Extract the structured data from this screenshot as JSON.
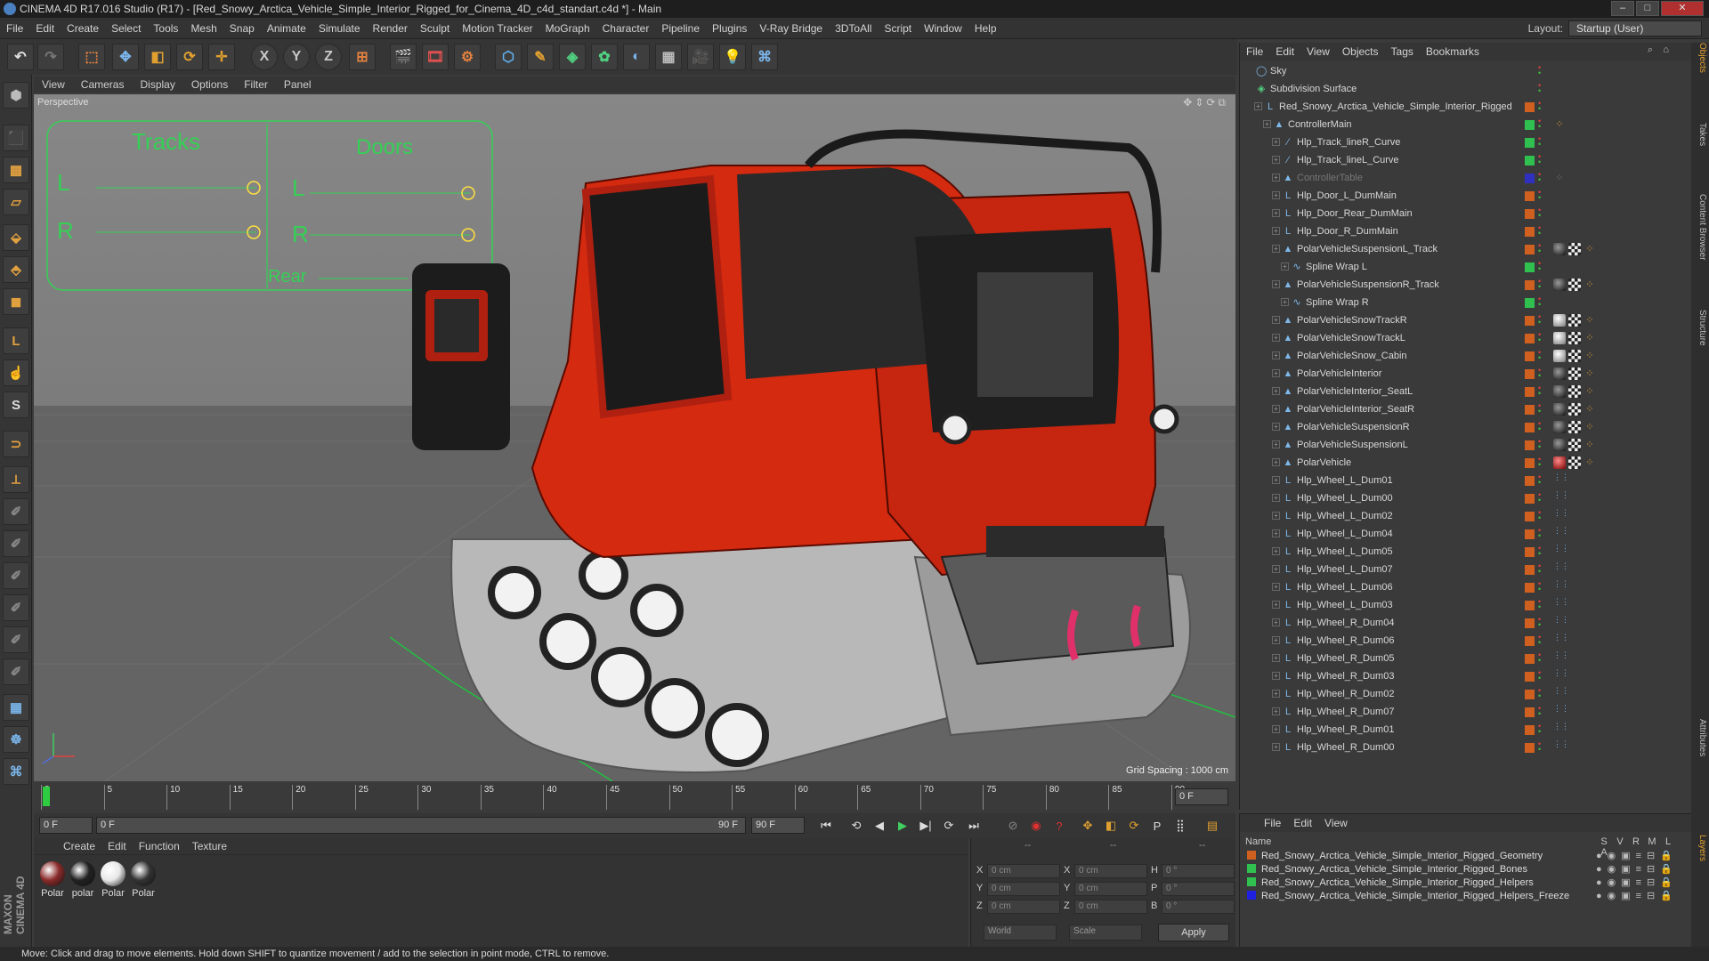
{
  "window": {
    "title": "CINEMA 4D R17.016 Studio (R17) - [Red_Snowy_Arctica_Vehicle_Simple_Interior_Rigged_for_Cinema_4D_c4d_standart.c4d *] - Main"
  },
  "menubar": {
    "items": [
      "File",
      "Edit",
      "Create",
      "Select",
      "Tools",
      "Mesh",
      "Snap",
      "Animate",
      "Simulate",
      "Render",
      "Sculpt",
      "Motion Tracker",
      "MoGraph",
      "Character",
      "Pipeline",
      "Plugins",
      "V-Ray Bridge",
      "3DToAll",
      "Script",
      "Window",
      "Help"
    ],
    "layout_label": "Layout:",
    "layout_value": "Startup (User)"
  },
  "toolbar": {
    "axis_x": "X",
    "axis_y": "Y",
    "axis_z": "Z"
  },
  "viewport": {
    "menu": [
      "View",
      "Cameras",
      "Display",
      "Options",
      "Filter",
      "Panel"
    ],
    "label": "Perspective",
    "grid_spacing": "Grid Spacing : 1000 cm",
    "hud": {
      "tracks_title": "Tracks",
      "doors_title": "Doors",
      "left": "L",
      "right": "R",
      "rear": "Rear"
    }
  },
  "timeline": {
    "ticks": [
      "0",
      "5",
      "10",
      "15",
      "20",
      "25",
      "30",
      "35",
      "40",
      "45",
      "50",
      "55",
      "60",
      "65",
      "70",
      "75",
      "80",
      "85",
      "90"
    ],
    "frame_right": "0 F",
    "current_frame": "0 F",
    "range_start": "0 F",
    "range_end_slider": "90 F",
    "range_end": "90 F"
  },
  "materials": {
    "menu": [
      "Create",
      "Edit",
      "Function",
      "Texture"
    ],
    "items": [
      {
        "label": "Polar",
        "color": "#8a2a2a"
      },
      {
        "label": "polar",
        "color": "#222222"
      },
      {
        "label": "Polar",
        "color": "#e8e8e8"
      },
      {
        "label": "Polar",
        "color": "#333333"
      }
    ]
  },
  "coordinates": {
    "header_dashes": "--",
    "x_label": "X",
    "y_label": "Y",
    "z_label": "Z",
    "h_label": "H",
    "p_label": "P",
    "b_label": "B",
    "pos_value": "0 cm",
    "rot_value": "0 °",
    "world": "World",
    "scale": "Scale",
    "apply": "Apply"
  },
  "object_manager": {
    "menu": [
      "File",
      "Edit",
      "View",
      "Objects",
      "Tags",
      "Bookmarks"
    ],
    "rows": [
      {
        "name": "Sky",
        "indent": 0,
        "icon": "sky",
        "layer": "",
        "tags": []
      },
      {
        "name": "Subdivision Surface",
        "indent": 0,
        "icon": "subdiv",
        "layer": "",
        "tags": []
      },
      {
        "name": "Red_Snowy_Arctica_Vehicle_Simple_Interior_Rigged",
        "indent": 1,
        "icon": "null",
        "layer": "#d06020",
        "tags": []
      },
      {
        "name": "ControllerMain",
        "indent": 2,
        "icon": "ctrl",
        "layer": "#30c050",
        "tags": [
          "orange"
        ]
      },
      {
        "name": "Hlp_Track_lineR_Curve",
        "indent": 3,
        "icon": "spline",
        "layer": "#30c050",
        "tags": []
      },
      {
        "name": "Hlp_Track_lineL_Curve",
        "indent": 3,
        "icon": "spline",
        "layer": "#30c050",
        "tags": []
      },
      {
        "name": "ControllerTable",
        "indent": 3,
        "icon": "ctrl",
        "layer": "#3030c0",
        "tags": [
          "grey"
        ],
        "dim": true
      },
      {
        "name": "Hlp_Door_L_DumMain",
        "indent": 3,
        "icon": "null",
        "layer": "#d06020",
        "tags": []
      },
      {
        "name": "Hlp_Door_Rear_DumMain",
        "indent": 3,
        "icon": "null",
        "layer": "#d06020",
        "tags": []
      },
      {
        "name": "Hlp_Door_R_DumMain",
        "indent": 3,
        "icon": "null",
        "layer": "#d06020",
        "tags": []
      },
      {
        "name": "PolarVehicleSuspensionL_Track",
        "indent": 3,
        "icon": "poly",
        "layer": "#d06020",
        "tags": [
          "dark",
          "checker",
          "orange"
        ]
      },
      {
        "name": "Spline Wrap L",
        "indent": 4,
        "icon": "deform",
        "layer": "#30c050",
        "tags": []
      },
      {
        "name": "PolarVehicleSuspensionR_Track",
        "indent": 3,
        "icon": "poly",
        "layer": "#d06020",
        "tags": [
          "dark",
          "checker",
          "orange"
        ]
      },
      {
        "name": "Spline Wrap R",
        "indent": 4,
        "icon": "deform",
        "layer": "#30c050",
        "tags": []
      },
      {
        "name": "PolarVehicleSnowTrackR",
        "indent": 3,
        "icon": "poly",
        "layer": "#d06020",
        "tags": [
          "white",
          "checker",
          "orange"
        ]
      },
      {
        "name": "PolarVehicleSnowTrackL",
        "indent": 3,
        "icon": "poly",
        "layer": "#d06020",
        "tags": [
          "white",
          "checker",
          "orange"
        ]
      },
      {
        "name": "PolarVehicleSnow_Cabin",
        "indent": 3,
        "icon": "poly",
        "layer": "#d06020",
        "tags": [
          "white",
          "checker",
          "orange"
        ]
      },
      {
        "name": "PolarVehicleInterior",
        "indent": 3,
        "icon": "poly",
        "layer": "#d06020",
        "tags": [
          "dark",
          "checker",
          "orange"
        ]
      },
      {
        "name": "PolarVehicleInterior_SeatL",
        "indent": 3,
        "icon": "poly",
        "layer": "#d06020",
        "tags": [
          "dark",
          "checker",
          "orange"
        ]
      },
      {
        "name": "PolarVehicleInterior_SeatR",
        "indent": 3,
        "icon": "poly",
        "layer": "#d06020",
        "tags": [
          "dark",
          "checker",
          "orange"
        ]
      },
      {
        "name": "PolarVehicleSuspensionR",
        "indent": 3,
        "icon": "poly",
        "layer": "#d06020",
        "tags": [
          "dark",
          "checker",
          "orange"
        ]
      },
      {
        "name": "PolarVehicleSuspensionL",
        "indent": 3,
        "icon": "poly",
        "layer": "#d06020",
        "tags": [
          "dark",
          "checker",
          "orange"
        ]
      },
      {
        "name": "PolarVehicle",
        "indent": 3,
        "icon": "poly",
        "layer": "#d06020",
        "tags": [
          "red",
          "checker",
          "orange"
        ]
      },
      {
        "name": "Hlp_Wheel_L_Dum01",
        "indent": 3,
        "icon": "null",
        "layer": "#d06020",
        "tags": [
          "dots"
        ]
      },
      {
        "name": "Hlp_Wheel_L_Dum00",
        "indent": 3,
        "icon": "null",
        "layer": "#d06020",
        "tags": [
          "dots"
        ]
      },
      {
        "name": "Hlp_Wheel_L_Dum02",
        "indent": 3,
        "icon": "null",
        "layer": "#d06020",
        "tags": [
          "dots"
        ]
      },
      {
        "name": "Hlp_Wheel_L_Dum04",
        "indent": 3,
        "icon": "null",
        "layer": "#d06020",
        "tags": [
          "dots"
        ]
      },
      {
        "name": "Hlp_Wheel_L_Dum05",
        "indent": 3,
        "icon": "null",
        "layer": "#d06020",
        "tags": [
          "dots"
        ]
      },
      {
        "name": "Hlp_Wheel_L_Dum07",
        "indent": 3,
        "icon": "null",
        "layer": "#d06020",
        "tags": [
          "dots"
        ]
      },
      {
        "name": "Hlp_Wheel_L_Dum06",
        "indent": 3,
        "icon": "null",
        "layer": "#d06020",
        "tags": [
          "dots"
        ]
      },
      {
        "name": "Hlp_Wheel_L_Dum03",
        "indent": 3,
        "icon": "null",
        "layer": "#d06020",
        "tags": [
          "dots"
        ]
      },
      {
        "name": "Hlp_Wheel_R_Dum04",
        "indent": 3,
        "icon": "null",
        "layer": "#d06020",
        "tags": [
          "dots"
        ]
      },
      {
        "name": "Hlp_Wheel_R_Dum06",
        "indent": 3,
        "icon": "null",
        "layer": "#d06020",
        "tags": [
          "dots"
        ]
      },
      {
        "name": "Hlp_Wheel_R_Dum05",
        "indent": 3,
        "icon": "null",
        "layer": "#d06020",
        "tags": [
          "dots"
        ]
      },
      {
        "name": "Hlp_Wheel_R_Dum03",
        "indent": 3,
        "icon": "null",
        "layer": "#d06020",
        "tags": [
          "dots"
        ]
      },
      {
        "name": "Hlp_Wheel_R_Dum02",
        "indent": 3,
        "icon": "null",
        "layer": "#d06020",
        "tags": [
          "dots"
        ]
      },
      {
        "name": "Hlp_Wheel_R_Dum07",
        "indent": 3,
        "icon": "null",
        "layer": "#d06020",
        "tags": [
          "dots"
        ]
      },
      {
        "name": "Hlp_Wheel_R_Dum01",
        "indent": 3,
        "icon": "null",
        "layer": "#d06020",
        "tags": [
          "dots"
        ]
      },
      {
        "name": "Hlp_Wheel_R_Dum00",
        "indent": 3,
        "icon": "null",
        "layer": "#d06020",
        "tags": [
          "dots"
        ]
      }
    ]
  },
  "side_tabs": [
    "Objects",
    "Takes",
    "Content Browser",
    "Structure",
    "Attributes",
    "Layers"
  ],
  "layer_manager": {
    "menu": [
      "File",
      "Edit",
      "View"
    ],
    "name_header": "Name",
    "columns": [
      "S",
      "V",
      "R",
      "M",
      "L",
      "A"
    ],
    "layers": [
      {
        "name": "Red_Snowy_Arctica_Vehicle_Simple_Interior_Rigged_Geometry",
        "color": "#d06020"
      },
      {
        "name": "Red_Snowy_Arctica_Vehicle_Simple_Interior_Rigged_Bones",
        "color": "#30c050"
      },
      {
        "name": "Red_Snowy_Arctica_Vehicle_Simple_Interior_Rigged_Helpers",
        "color": "#30c050"
      },
      {
        "name": "Red_Snowy_Arctica_Vehicle_Simple_Interior_Rigged_Helpers_Freeze",
        "color": "#2020e0"
      }
    ]
  },
  "status": {
    "text": "Move: Click and drag to move elements. Hold down SHIFT to quantize movement / add to the selection in point mode, CTRL to remove."
  },
  "branding": {
    "maxon": "MAXON",
    "cinema": "CINEMA 4D"
  }
}
